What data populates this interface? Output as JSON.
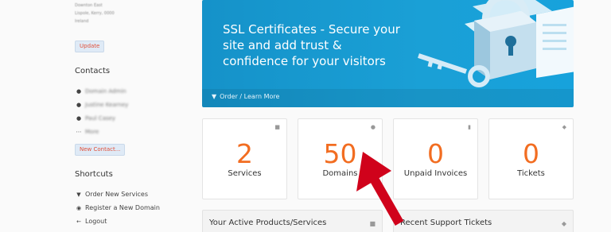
{
  "sidebar": {
    "address_lines": [
      "Downton East",
      "Lispole, Kerry, 0000",
      "Ireland"
    ],
    "update_label": "Update",
    "contacts_title": "Contacts",
    "contacts": [
      {
        "label": "Domain Admin",
        "icon": "user-icon"
      },
      {
        "label": "Justine Kearney",
        "icon": "user-icon"
      },
      {
        "label": "Paul Casey",
        "icon": "user-icon"
      },
      {
        "label": "More",
        "icon": "ellipsis-icon"
      }
    ],
    "new_contact_label": "New Contact...",
    "shortcuts_title": "Shortcuts",
    "shortcuts": [
      {
        "label": "Order New Services",
        "icon": "basket-icon"
      },
      {
        "label": "Register a New Domain",
        "icon": "globe-icon"
      },
      {
        "label": "Logout",
        "icon": "arrow-left-icon"
      }
    ]
  },
  "banner": {
    "title": "SSL Certificates - Secure your site and add trust & confidence for your visitors",
    "footer_label": "Order / Learn More",
    "colors": {
      "start": "#1592c9",
      "end": "#17a2dc"
    }
  },
  "stats": [
    {
      "value": "2",
      "label": "Services",
      "icon": "cube-icon"
    },
    {
      "value": "50",
      "label": "Domains",
      "icon": "globe-icon"
    },
    {
      "value": "0",
      "label": "Unpaid Invoices",
      "icon": "file-icon"
    },
    {
      "value": "0",
      "label": "Tickets",
      "icon": "comment-icon"
    }
  ],
  "panels": [
    {
      "title": "Your Active Products/Services",
      "icon": "cube-icon"
    },
    {
      "title": "Recent Support Tickets",
      "icon": "comment-icon"
    }
  ],
  "accent_color": "#f26d21",
  "annotation_color": "#d0021b"
}
